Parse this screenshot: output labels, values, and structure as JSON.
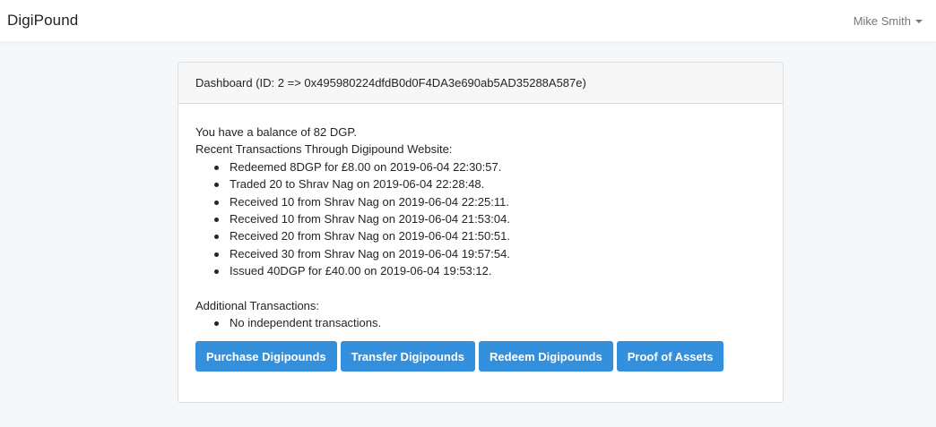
{
  "navbar": {
    "brand": "DigiPound",
    "user_name": "Mike Smith"
  },
  "dashboard": {
    "header": "Dashboard (ID: 2 => 0x495980224dfdB0d0F4DA3e690ab5AD35288A587e)",
    "balance_text": "You have a balance of 82 DGP.",
    "recent_heading": "Recent Transactions Through Digipound Website:",
    "recent_transactions": [
      "Redeemed 8DGP for £8.00 on 2019-06-04 22:30:57.",
      "Traded 20 to Shrav Nag on 2019-06-04 22:28:48.",
      "Received 10 from Shrav Nag on 2019-06-04 22:25:11.",
      "Received 10 from Shrav Nag on 2019-06-04 21:53:04.",
      "Received 20 from Shrav Nag on 2019-06-04 21:50:51.",
      "Received 30 from Shrav Nag on 2019-06-04 19:57:54.",
      "Issued 40DGP for £40.00 on 2019-06-04 19:53:12."
    ],
    "additional_heading": "Additional Transactions:",
    "additional_transactions": [
      "No independent transactions."
    ],
    "buttons": {
      "purchase": "Purchase Digipounds",
      "transfer": "Transfer Digipounds",
      "redeem": "Redeem Digipounds",
      "proof": "Proof of Assets"
    }
  },
  "colors": {
    "primary_button": "#3490dc",
    "page_background": "#f5f8fa",
    "card_header_background": "#f7f7f7"
  },
  "icons": {
    "user_menu_caret": "caret-down-icon"
  }
}
